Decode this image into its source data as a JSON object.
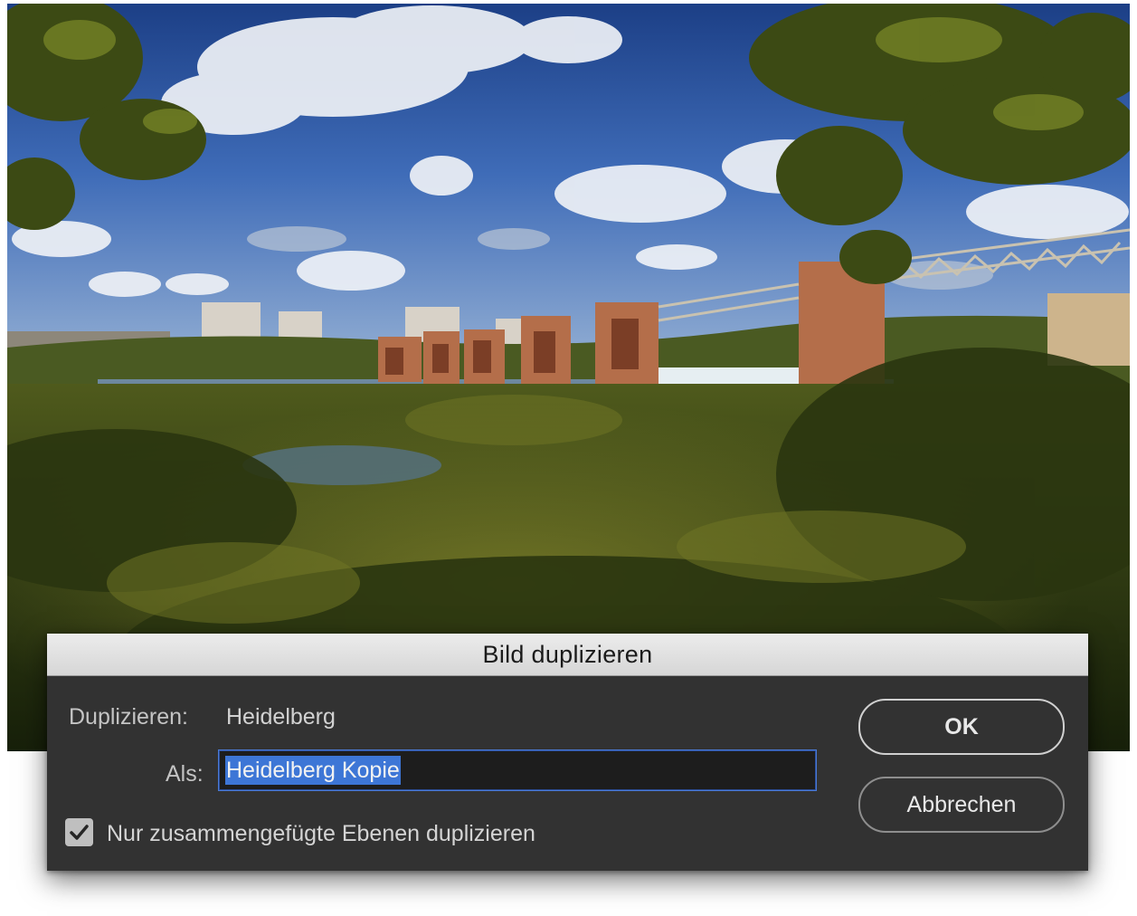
{
  "dialog": {
    "title": "Bild duplizieren",
    "duplicate_label": "Duplizieren:",
    "duplicate_value": "Heidelberg",
    "as_label": "Als:",
    "as_value": "Heidelberg Kopie",
    "checkbox_label": "Nur zusammengefügte Ebenen duplizieren",
    "checkbox_checked": true,
    "ok_label": "OK",
    "cancel_label": "Abbrechen"
  },
  "colors": {
    "dialog_bg": "#323232",
    "titlebar_bg": "#dcdcdc",
    "selection": "#3d76d6",
    "focus_ring": "#4a7ad6"
  },
  "icons": {
    "checkbox": "checkmark-icon"
  }
}
